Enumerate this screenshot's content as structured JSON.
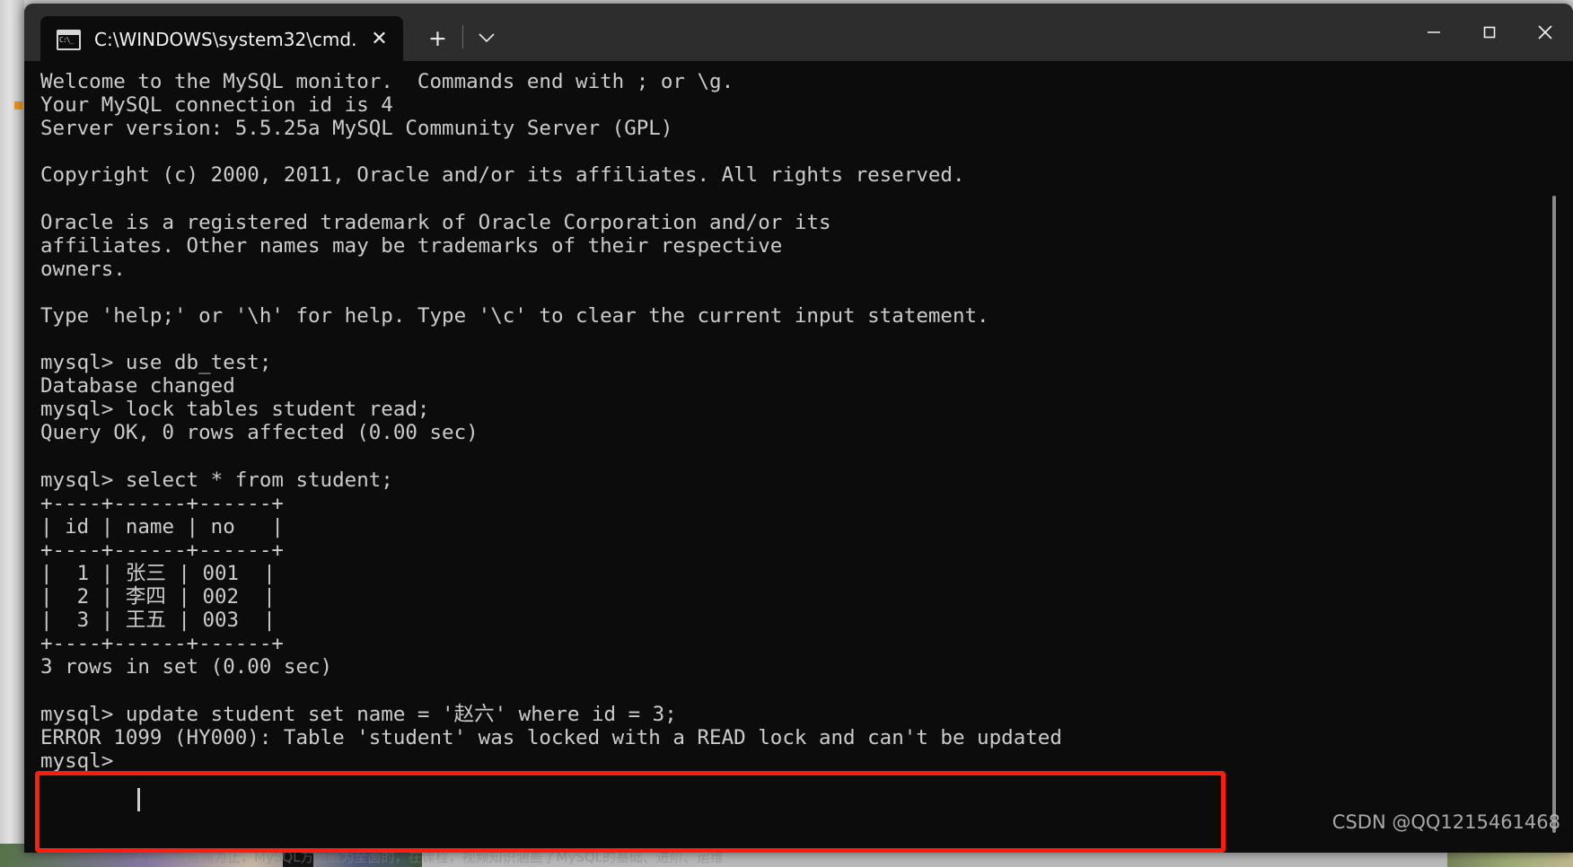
{
  "window": {
    "title": "C:\\WINDOWS\\system32\\cmd.",
    "tab_close_label": "✕",
    "new_tab_label": "+",
    "dropdown_label": "⌄",
    "minimize_label": "minimize-icon",
    "maximize_label": "maximize-icon",
    "close_label": "close-icon",
    "app_icon_name": "cmd-console-icon"
  },
  "terminal": {
    "lines": [
      "Welcome to the MySQL monitor.  Commands end with ; or \\g.",
      "Your MySQL connection id is 4",
      "Server version: 5.5.25a MySQL Community Server (GPL)",
      "",
      "Copyright (c) 2000, 2011, Oracle and/or its affiliates. All rights reserved.",
      "",
      "Oracle is a registered trademark of Oracle Corporation and/or its",
      "affiliates. Other names may be trademarks of their respective",
      "owners.",
      "",
      "Type 'help;' or '\\h' for help. Type '\\c' to clear the current input statement.",
      "",
      "mysql> use db_test;",
      "Database changed",
      "mysql> lock tables student read;",
      "Query OK, 0 rows affected (0.00 sec)",
      "",
      "mysql> select * from student;",
      "+----+------+------+",
      "| id | name | no   |",
      "+----+------+------+",
      "|  1 | 张三 | 001  |",
      "|  2 | 李四 | 002  |",
      "|  3 | 王五 | 003  |",
      "+----+------+------+",
      "3 rows in set (0.00 sec)",
      "",
      "mysql> update student set name = '赵六' where id = 3;",
      "ERROR 1099 (HY000): Table 'student' was locked with a READ lock and can't be updated",
      "mysql> "
    ],
    "prompt": "mysql>",
    "query_table": {
      "type": "table",
      "columns": [
        "id",
        "name",
        "no"
      ],
      "rows": [
        [
          "1",
          "张三",
          "001"
        ],
        [
          "2",
          "李四",
          "002"
        ],
        [
          "3",
          "王五",
          "003"
        ]
      ],
      "footer": "3 rows in set (0.00 sec)"
    },
    "error_message": "ERROR 1099 (HY000): Table 'student' was locked with a READ lock and can't be updated",
    "highlight_color": "#fd1c10"
  },
  "watermark": {
    "text": "CSDN @QQ1215461468"
  },
  "page_background": {
    "caption_fragment": "本课程是目前为止，MySQL方面最为全面的，在课程，视频知识涵盖了MySQL的基础、进阶、运维"
  }
}
